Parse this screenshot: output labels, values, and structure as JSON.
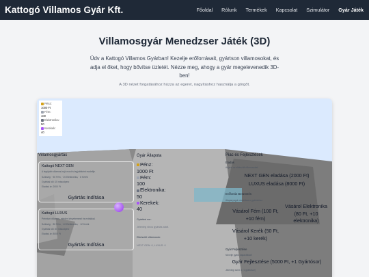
{
  "header": {
    "brand": "Kattogó Villamos Gyár Kft.",
    "nav": [
      "Főoldal",
      "Rólunk",
      "Termékek",
      "Kapcsolat",
      "Szimulátor",
      "Gyár Játék"
    ],
    "active_index": 5
  },
  "hero": {
    "title": "Villamosgyár Menedzser Játék (3D)",
    "description": "Üdv a Kattogó Villamos Gyárban! Kezelje erőforrásait, gyártson villamosokat, és adja el őket, hogy bővítse üzletét. Nézze meg, ahogy a gyár megelevenedik 3D-ben!",
    "hint": "A 3D nézet forgatásához húzza az egeret, nagyításhoz használja a görgőt."
  },
  "stats_overlay": {
    "items": [
      {
        "label": "Pénz:",
        "value": "1000 Ft",
        "icon": "money-bag-icon",
        "color": "#d4a017"
      },
      {
        "label": "Fém:",
        "value": "100",
        "icon": "metal-icon",
        "color": "#9ca3af"
      },
      {
        "label": "Elektronika:",
        "value": "50",
        "icon": "plug-icon",
        "color": "#6b7280"
      },
      {
        "label": "Kerekek:",
        "value": "40",
        "icon": "wheel-icon",
        "color": "#a855f7"
      }
    ]
  },
  "production": {
    "title": "Villamosgyártás",
    "cards": [
      {
        "name": "Kattogó NEXT GEN",
        "desc": "A legújabb villamos-hajó most is legjobbként modellje.",
        "req": "Szükség: · 50 Fém, · 20 Elektronika, · 8 Kerék",
        "time": "Gyártási idő: 15 másodperc",
        "price": "Eladási ár: 2000 Ft",
        "button": "Gyártás Indítása"
      },
      {
        "name": "Kattogó LUXUS",
        "desc": "Prémium villamos, minden kényelemmel és extrákkal.",
        "req": "Szükség: · 80 Fém, · 40 Elektronika, · 12 Kerék",
        "time": "Gyártási idő: 30 másodperc",
        "price": "Eladási ár: 8000 Ft",
        "button": "Gyártás Indítása"
      }
    ]
  },
  "factory_status": {
    "title": "Gyár Állapota",
    "money_label": "Pénz:",
    "money": "1000 Ft",
    "metal_label": "Fém:",
    "metal": "100",
    "electronics_label": "Elektronika:",
    "electronics": "50",
    "wheels_label": "Kerekek:",
    "wheels": "40",
    "queue_title": "Gyártási sor:",
    "queue_text": "Jelenleg nincs gyártás alatt.",
    "built_title": "Elkészült villamosok:",
    "built_text": "NEXT GEN: 0, LUXUS: 0"
  },
  "market": {
    "title": "Piac és Fejlesztések",
    "sell_title": "Eladás",
    "sell_sub": "Adja el az elkészült villamosokat.",
    "sell_next": "NEXT GEN eladása (2000 Ft)",
    "sell_luxus": "LUXUS eladása (8000 Ft)",
    "buy_title": "Erőforrás Beszerzés",
    "buy_sub": "Alapanyagok vásárlása a gyártáshoz.",
    "buy_metal": "Vásárol Fém (100 Ft, +10 fém)",
    "buy_electronics": "Vásárol Elektronika (80 Ft, +10 elektronika)",
    "buy_wheels": "Vásárol Kerék (50 Ft, +10 kerék)",
    "upgrade_title": "Gyár Fejlesztése",
    "upgrade_sub": "Növelje gyára kapacitását!",
    "upgrade_btn": "Gyár Fejlesztése (5000 Ft, +1 Gyártósor)",
    "upgrade_level": "Jelenlegi szint: 1 (1 gyártósor)"
  }
}
